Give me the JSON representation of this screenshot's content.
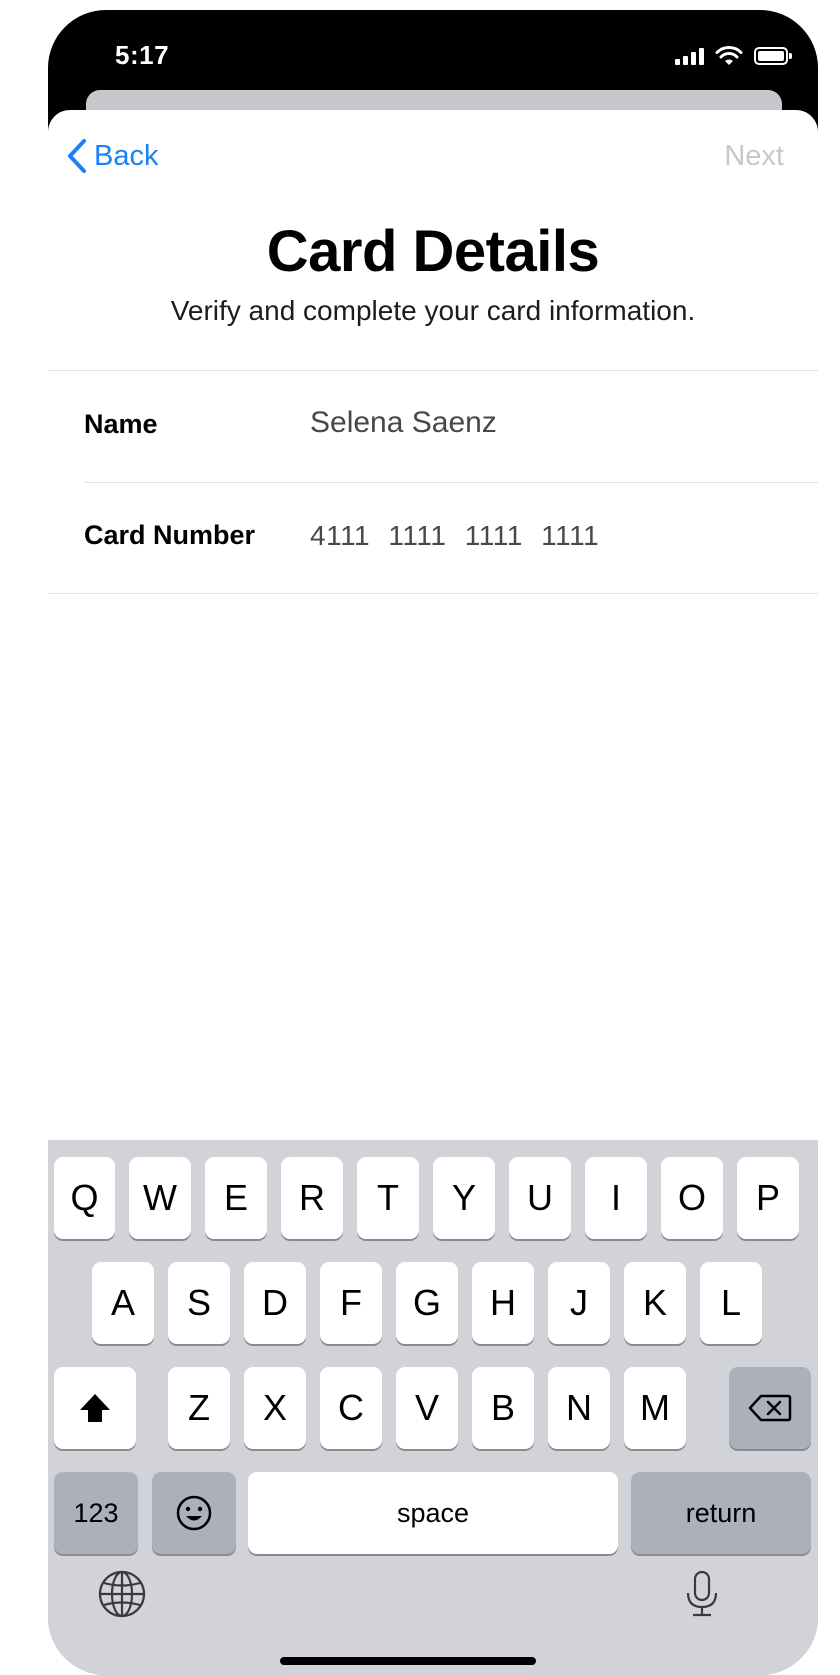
{
  "status_bar": {
    "time": "5:17",
    "icons": [
      "cellular-signal-icon",
      "wifi-icon",
      "battery-icon"
    ]
  },
  "nav": {
    "back_label": "Back",
    "next_label": "Next",
    "back_color": "#1a82f7",
    "next_color": "#c7c7cc"
  },
  "header": {
    "title": "Card Details",
    "subtitle": "Verify and complete your card information."
  },
  "form": {
    "name_label": "Name",
    "name_value": "Selena Saenz",
    "card_label": "Card Number",
    "card_value": "4111  1111  1111  1111"
  },
  "keyboard": {
    "row1": [
      "Q",
      "W",
      "E",
      "R",
      "T",
      "Y",
      "U",
      "I",
      "O",
      "P"
    ],
    "row2": [
      "A",
      "S",
      "D",
      "F",
      "G",
      "H",
      "J",
      "K",
      "L"
    ],
    "row3": [
      "Z",
      "X",
      "C",
      "V",
      "B",
      "N",
      "M"
    ],
    "numbers_label": "123",
    "space_label": "space",
    "return_label": "return",
    "icons": [
      "shift-icon",
      "backspace-icon",
      "emoji-icon",
      "globe-icon",
      "microphone-icon"
    ]
  }
}
